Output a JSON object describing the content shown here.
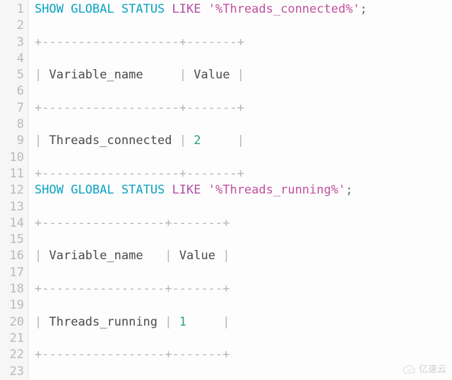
{
  "line_count": 23,
  "lines": {
    "1": [
      [
        "kw",
        "SHOW"
      ],
      [
        "sp",
        " "
      ],
      [
        "kw",
        "GLOBAL"
      ],
      [
        "sp",
        " "
      ],
      [
        "kw",
        "STATUS"
      ],
      [
        "sp",
        " "
      ],
      [
        "like",
        "LIKE"
      ],
      [
        "sp",
        " "
      ],
      [
        "str",
        "'%Threads_connected%'"
      ],
      [
        "pun",
        ";"
      ]
    ],
    "2": [],
    "3": [
      [
        "rule",
        "+-------------------+-------+"
      ]
    ],
    "4": [],
    "5": [
      [
        "pipe",
        "|"
      ],
      [
        "sp",
        " "
      ],
      [
        "txt",
        "Variable_name"
      ],
      [
        "sp",
        "     "
      ],
      [
        "pipe",
        "|"
      ],
      [
        "sp",
        " "
      ],
      [
        "txt",
        "Value"
      ],
      [
        "sp",
        " "
      ],
      [
        "pipe",
        "|"
      ]
    ],
    "6": [],
    "7": [
      [
        "rule",
        "+-------------------+-------+"
      ]
    ],
    "8": [],
    "9": [
      [
        "pipe",
        "|"
      ],
      [
        "sp",
        " "
      ],
      [
        "txt",
        "Threads_connected"
      ],
      [
        "sp",
        " "
      ],
      [
        "pipe",
        "|"
      ],
      [
        "sp",
        " "
      ],
      [
        "num",
        "2"
      ],
      [
        "sp",
        "     "
      ],
      [
        "pipe",
        "|"
      ]
    ],
    "10": [],
    "11": [
      [
        "rule",
        "+-------------------+-------+"
      ]
    ],
    "12": [
      [
        "kw",
        "SHOW"
      ],
      [
        "sp",
        " "
      ],
      [
        "kw",
        "GLOBAL"
      ],
      [
        "sp",
        " "
      ],
      [
        "kw",
        "STATUS"
      ],
      [
        "sp",
        " "
      ],
      [
        "like",
        "LIKE"
      ],
      [
        "sp",
        " "
      ],
      [
        "str",
        "'%Threads_running%'"
      ],
      [
        "pun",
        ";"
      ]
    ],
    "13": [],
    "14": [
      [
        "rule",
        "+-----------------+-------+"
      ]
    ],
    "15": [],
    "16": [
      [
        "pipe",
        "|"
      ],
      [
        "sp",
        " "
      ],
      [
        "txt",
        "Variable_name"
      ],
      [
        "sp",
        "   "
      ],
      [
        "pipe",
        "|"
      ],
      [
        "sp",
        " "
      ],
      [
        "txt",
        "Value"
      ],
      [
        "sp",
        " "
      ],
      [
        "pipe",
        "|"
      ]
    ],
    "17": [],
    "18": [
      [
        "rule",
        "+-----------------+-------+"
      ]
    ],
    "19": [],
    "20": [
      [
        "pipe",
        "|"
      ],
      [
        "sp",
        " "
      ],
      [
        "txt",
        "Threads_running"
      ],
      [
        "sp",
        " "
      ],
      [
        "pipe",
        "|"
      ],
      [
        "sp",
        " "
      ],
      [
        "num",
        "1"
      ],
      [
        "sp",
        "     "
      ],
      [
        "pipe",
        "|"
      ]
    ],
    "21": [],
    "22": [
      [
        "rule",
        "+-----------------+-------+"
      ]
    ],
    "23": []
  },
  "watermark": "亿速云"
}
